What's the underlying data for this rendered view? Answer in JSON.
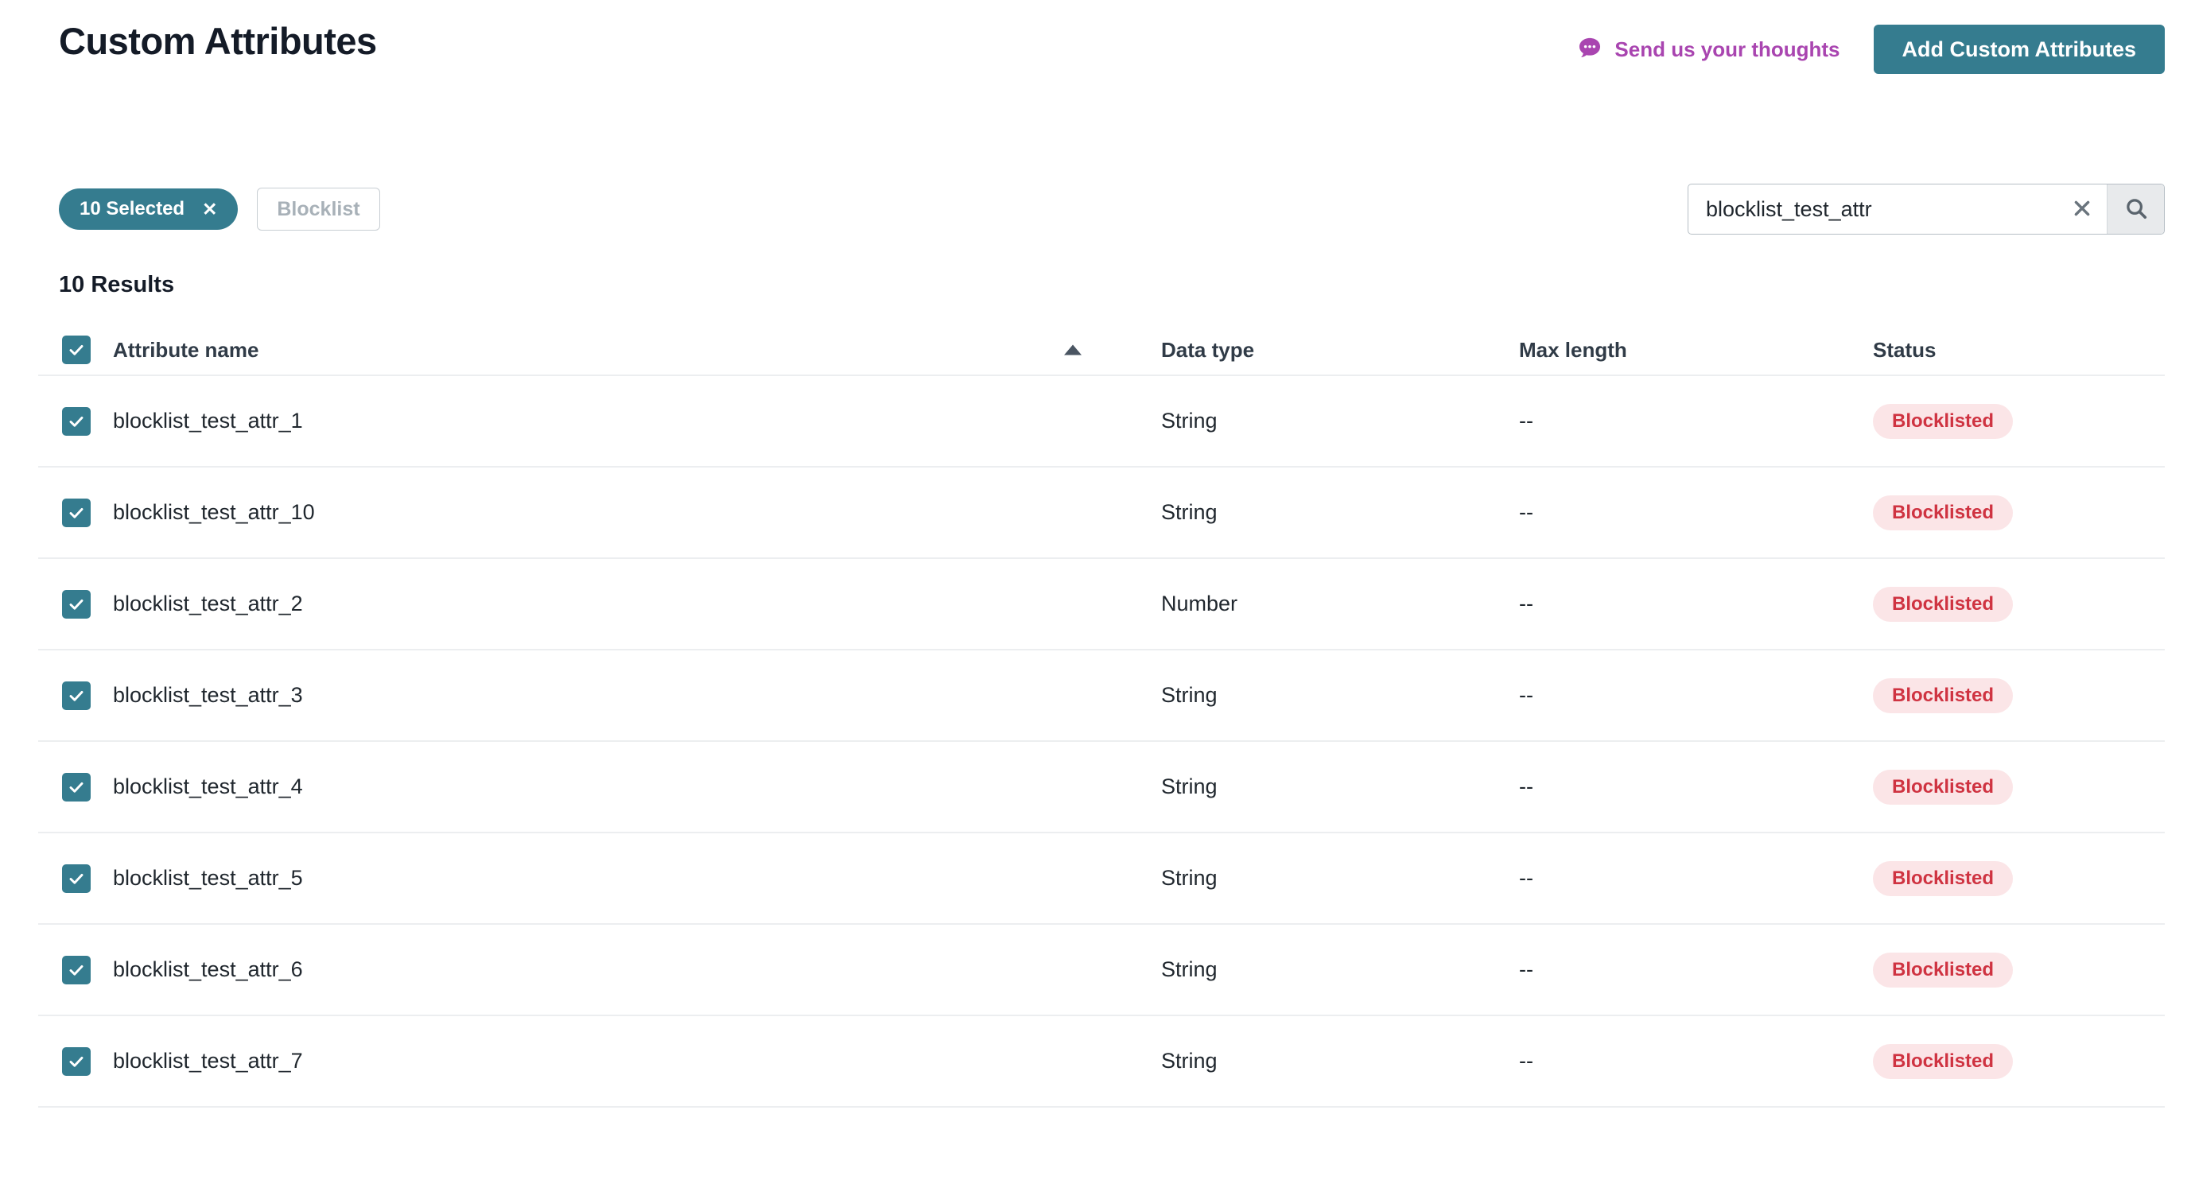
{
  "header": {
    "title": "Custom Attributes",
    "feedback_label": "Send us your thoughts",
    "feedback_icon": "speech-bubble-icon",
    "add_button_label": "Add Custom Attributes",
    "accent_teal": "#357c8f",
    "feedback_purple": "#a945b0"
  },
  "toolbar": {
    "selected_chip_label": "10 Selected",
    "selected_chip_remove": "✕",
    "blocklist_button_label": "Blocklist",
    "blocklist_button_disabled": true
  },
  "search": {
    "value": "blocklist_test_attr",
    "placeholder": "Search",
    "clear_icon": "close-icon",
    "submit_icon": "search-icon"
  },
  "results": {
    "count_label": "10 Results",
    "columns": {
      "name": "Attribute name",
      "data_type": "Data type",
      "max_length": "Max length",
      "status": "Status"
    },
    "sort": {
      "column": "Attribute name",
      "direction": "ascending",
      "icon": "caret-up-icon"
    },
    "header_checkbox_checked": true,
    "rows": [
      {
        "checked": true,
        "name": "blocklist_test_attr_1",
        "data_type": "String",
        "max_length": "--",
        "status": "Blocklisted"
      },
      {
        "checked": true,
        "name": "blocklist_test_attr_10",
        "data_type": "String",
        "max_length": "--",
        "status": "Blocklisted"
      },
      {
        "checked": true,
        "name": "blocklist_test_attr_2",
        "data_type": "Number",
        "max_length": "--",
        "status": "Blocklisted"
      },
      {
        "checked": true,
        "name": "blocklist_test_attr_3",
        "data_type": "String",
        "max_length": "--",
        "status": "Blocklisted"
      },
      {
        "checked": true,
        "name": "blocklist_test_attr_4",
        "data_type": "String",
        "max_length": "--",
        "status": "Blocklisted"
      },
      {
        "checked": true,
        "name": "blocklist_test_attr_5",
        "data_type": "String",
        "max_length": "--",
        "status": "Blocklisted"
      },
      {
        "checked": true,
        "name": "blocklist_test_attr_6",
        "data_type": "String",
        "max_length": "--",
        "status": "Blocklisted"
      },
      {
        "checked": true,
        "name": "blocklist_test_attr_7",
        "data_type": "String",
        "max_length": "--",
        "status": "Blocklisted"
      }
    ],
    "status_badge_colors": {
      "background": "#fbe5e7",
      "text": "#cf3341"
    }
  }
}
